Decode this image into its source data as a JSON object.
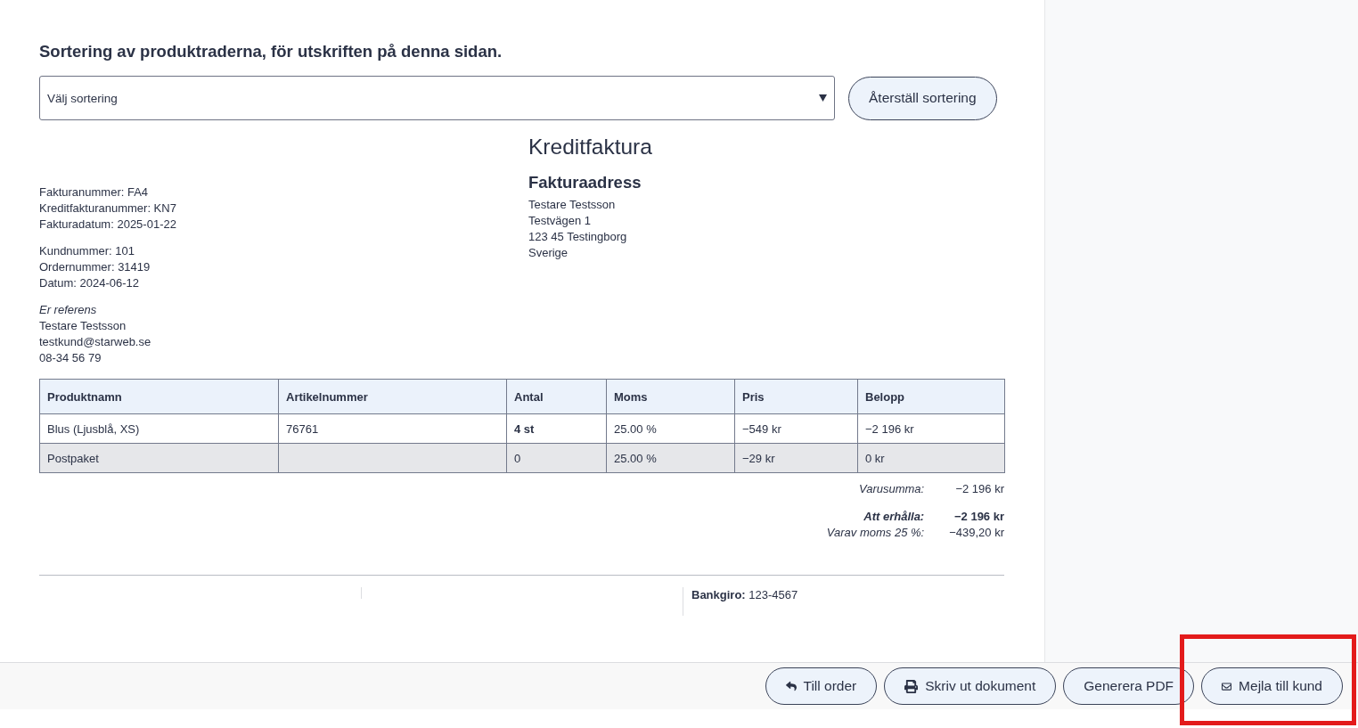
{
  "sort_section": {
    "heading": "Sortering av produktraderna, för utskriften på denna sidan.",
    "select": {
      "value": "Välj sortering"
    },
    "reset_button": "Återställ sortering"
  },
  "invoice": {
    "title": "Kreditfaktura",
    "info_groups": [
      {
        "lines": [
          "Fakturanummer: FA4",
          "Kreditfakturanummer: KN7",
          "Fakturadatum: 2025-01-22"
        ]
      },
      {
        "lines": [
          "Kundnummer: 101",
          "Ordernummer: 31419",
          "Datum: 2024-06-12"
        ]
      },
      {
        "heading": "Er referens",
        "lines": [
          "Testare Testsson",
          "testkund@starweb.se",
          "08-34 56 79"
        ]
      }
    ],
    "billing_address": {
      "heading": "Fakturaadress",
      "lines": [
        "Testare Testsson",
        "Testvägen 1",
        "123 45 Testingborg",
        "Sverige"
      ]
    }
  },
  "table": {
    "columns": [
      "Produktnamn",
      "Artikelnummer",
      "Antal",
      "Moms",
      "Pris",
      "Belopp"
    ],
    "rows": [
      {
        "kind": "product",
        "cells": [
          "Blus (Ljusblå, XS)",
          "76761",
          "4 st",
          "25.00 %",
          "−549 kr",
          "−2 196 kr"
        ]
      },
      {
        "kind": "shipping",
        "cells": [
          "Postpaket",
          "",
          "0",
          "25.00 %",
          "−29 kr",
          "0 kr"
        ]
      }
    ]
  },
  "totals": [
    {
      "kind": "subtotal",
      "label": "Varusumma:",
      "value": "−2 196 kr"
    },
    {
      "kind": "total",
      "label": "Att erhålla:",
      "value": "−2 196 kr"
    },
    {
      "kind": "tax",
      "label": "Varav moms 25 %:",
      "value": "−439,20 kr"
    }
  ],
  "footer": {
    "payment_info": "**Bankgiro:** 123-4567"
  },
  "action_bar": {
    "buttons": [
      {
        "kind": "back",
        "label": "Till order",
        "highlighted": false
      },
      {
        "kind": "print",
        "label": "Skriv ut dokument",
        "highlighted": false
      },
      {
        "kind": "pdf",
        "label": "Generera PDF",
        "highlighted": false
      },
      {
        "kind": "email",
        "label": "Mejla till kund",
        "highlighted": true
      }
    ]
  }
}
